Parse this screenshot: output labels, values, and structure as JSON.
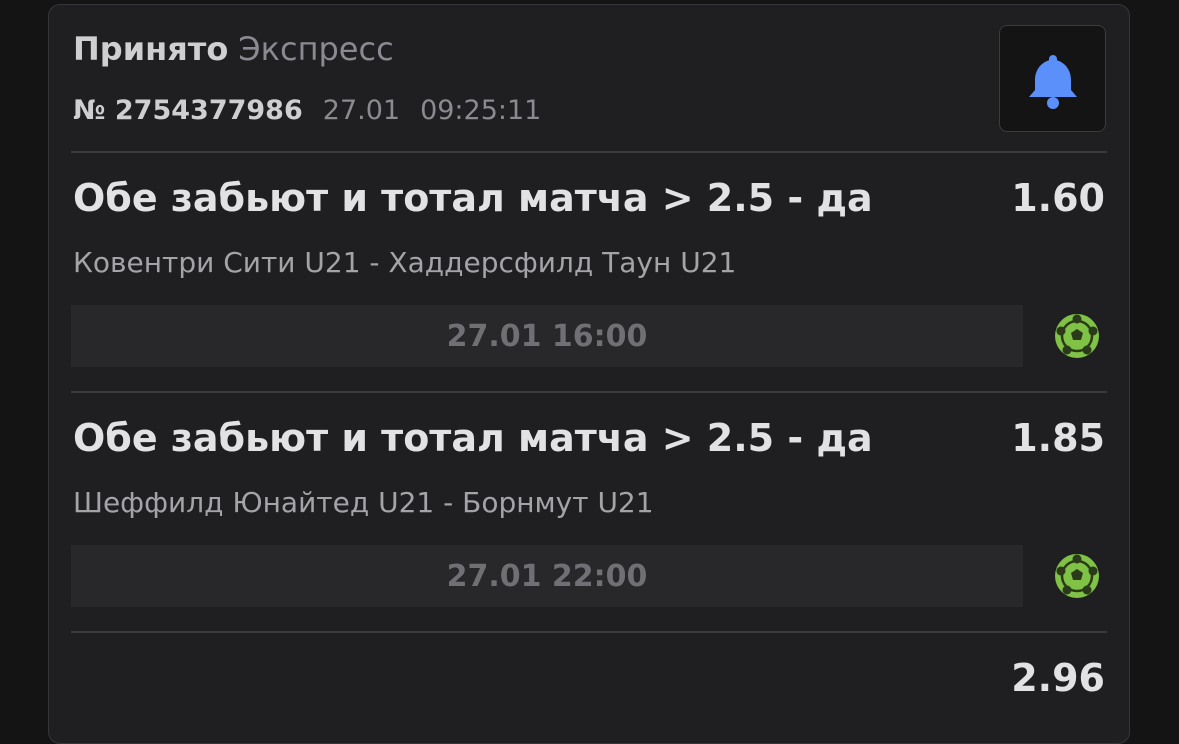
{
  "header": {
    "status": "Принято",
    "bet_type": "Экспресс",
    "number": "№ 2754377986",
    "date": "27.01",
    "time": "09:25:11",
    "bell_icon": "bell-icon",
    "bell_color": "#5b8ff9"
  },
  "events": [
    {
      "market": "Обе забьют и тотал матча > 2.5 - да",
      "odds": "1.60",
      "teams": "Ковентри Сити U21 - Хаддерсфилд Таун U21",
      "start": "27.01 16:00",
      "sport_icon": "soccer-ball-icon"
    },
    {
      "market": "Обе забьют и тотал матча > 2.5 - да",
      "odds": "1.85",
      "teams": "Шеффилд Юнайтед U21 - Борнмут U21",
      "start": "27.01 22:00",
      "sport_icon": "soccer-ball-icon"
    }
  ],
  "total_odds": "2.96",
  "colors": {
    "card_bg": "#1f1f21",
    "ball_green": "#7fc246"
  }
}
